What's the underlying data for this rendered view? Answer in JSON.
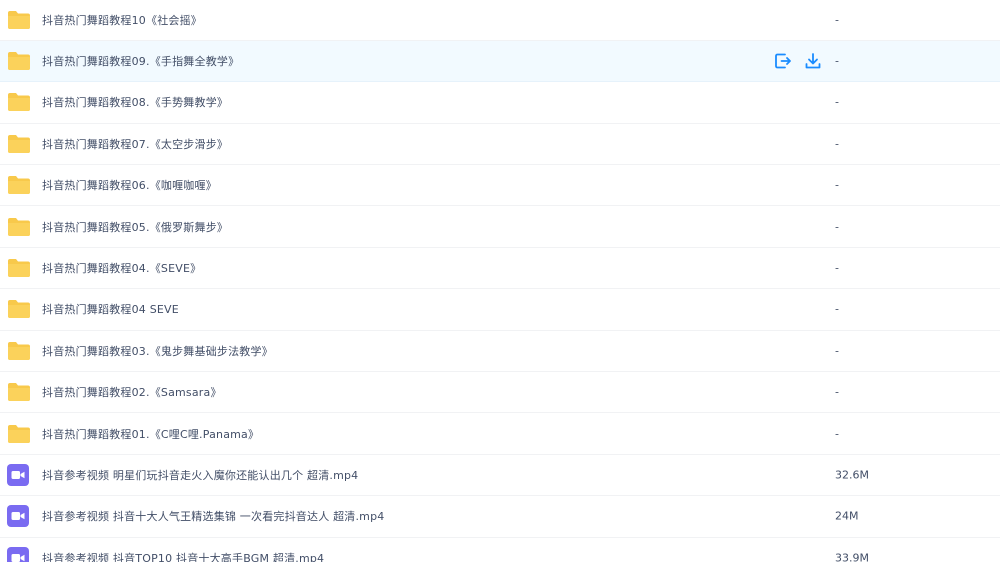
{
  "colors": {
    "folder": "#f8c94b",
    "video": "#7a6bf1",
    "action": "#1a8cff",
    "hover_bg": "#f2faff"
  },
  "files": [
    {
      "type": "folder",
      "name": "抖音热门舞蹈教程10《社会摇》",
      "size": "-"
    },
    {
      "type": "folder",
      "name": "抖音热门舞蹈教程09.《手指舞全教学》",
      "size": "-",
      "hover": true
    },
    {
      "type": "folder",
      "name": "抖音热门舞蹈教程08.《手势舞教学》",
      "size": "-"
    },
    {
      "type": "folder",
      "name": "抖音热门舞蹈教程07.《太空步滑步》",
      "size": "-"
    },
    {
      "type": "folder",
      "name": "抖音热门舞蹈教程06.《咖喱咖喱》",
      "size": "-"
    },
    {
      "type": "folder",
      "name": "抖音热门舞蹈教程05.《俄罗斯舞步》",
      "size": "-"
    },
    {
      "type": "folder",
      "name": "抖音热门舞蹈教程04.《SEVE》",
      "size": "-"
    },
    {
      "type": "folder",
      "name": "抖音热门舞蹈教程04 SEVE",
      "size": "-"
    },
    {
      "type": "folder",
      "name": "抖音热门舞蹈教程03.《鬼步舞基础步法教学》",
      "size": "-"
    },
    {
      "type": "folder",
      "name": "抖音热门舞蹈教程02.《Samsara》",
      "size": "-"
    },
    {
      "type": "folder",
      "name": "抖音热门舞蹈教程01.《C哩C哩.Panama》",
      "size": "-"
    },
    {
      "type": "video",
      "name": "抖音参考视频 明星们玩抖音走火入魔你还能认出几个 超清.mp4",
      "size": "32.6M"
    },
    {
      "type": "video",
      "name": "抖音参考视频 抖音十大人气王精选集锦 一次看完抖音达人 超清.mp4",
      "size": "24M"
    },
    {
      "type": "video",
      "name": "抖音参考视频 抖音TOP10 抖音十大高手BGM 超清.mp4",
      "size": "33.9M"
    }
  ]
}
